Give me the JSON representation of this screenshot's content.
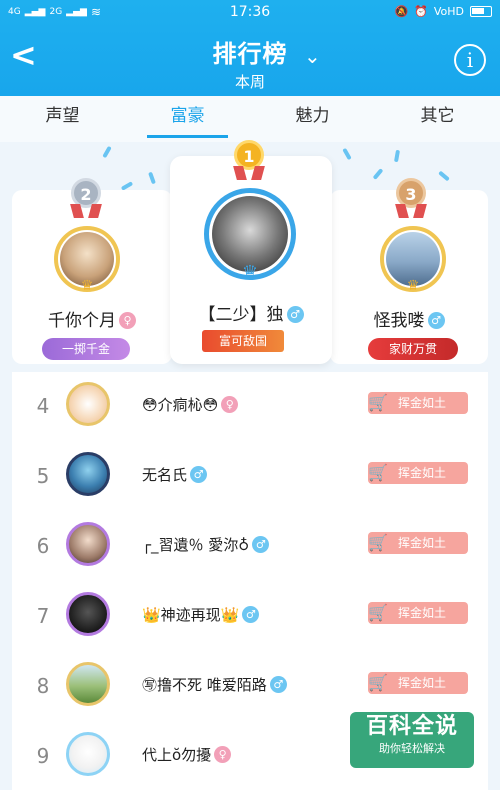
{
  "status": {
    "left_signals": [
      "4G",
      "2G"
    ],
    "time": "17:36",
    "right_icons": [
      "VoHD"
    ]
  },
  "header": {
    "title": "排行榜",
    "subtitle": "本周",
    "back": "<",
    "chevron": "⌄",
    "info": "i"
  },
  "tabs": [
    {
      "label": "声望"
    },
    {
      "label": "富豪"
    },
    {
      "label": "魅力"
    },
    {
      "label": "其它"
    }
  ],
  "podium": [
    {
      "rank": "2",
      "name": "千你个月",
      "gender": "f",
      "badge": "一掷千金",
      "medal_color": "#a9b4c2"
    },
    {
      "rank": "1",
      "name": "【二少】独",
      "gender": "m",
      "badge": "富可敌国",
      "medal_color": "#f4b322"
    },
    {
      "rank": "3",
      "name": "怪我喽",
      "gender": "m",
      "badge": "家财万贯",
      "medal_color": "#d8a26b"
    }
  ],
  "list": [
    {
      "rank": "4",
      "name": "😳介痌杺😳",
      "gender": "f",
      "badge": "挥金如土"
    },
    {
      "rank": "5",
      "name": "无名氏",
      "gender": "m",
      "badge": "挥金如土"
    },
    {
      "rank": "6",
      "name": "┌_習遺％  愛沵♁",
      "gender": "m",
      "badge": "挥金如土"
    },
    {
      "rank": "7",
      "name": "👑神迹再现👑",
      "gender": "m",
      "badge": "挥金如土"
    },
    {
      "rank": "8",
      "name": "㊢撸不死  唯爱陌路",
      "gender": "m",
      "badge": "挥金如土"
    },
    {
      "rank": "9",
      "name": "代上ŏ勿擾",
      "gender": "f",
      "badge": ""
    }
  ],
  "watermark": {
    "main": "百科全说",
    "sub": "助你轻松解决"
  },
  "colors": {
    "header": "#1fb0ef",
    "accent": "#1ba4ea",
    "badge": "#f6a59e"
  }
}
